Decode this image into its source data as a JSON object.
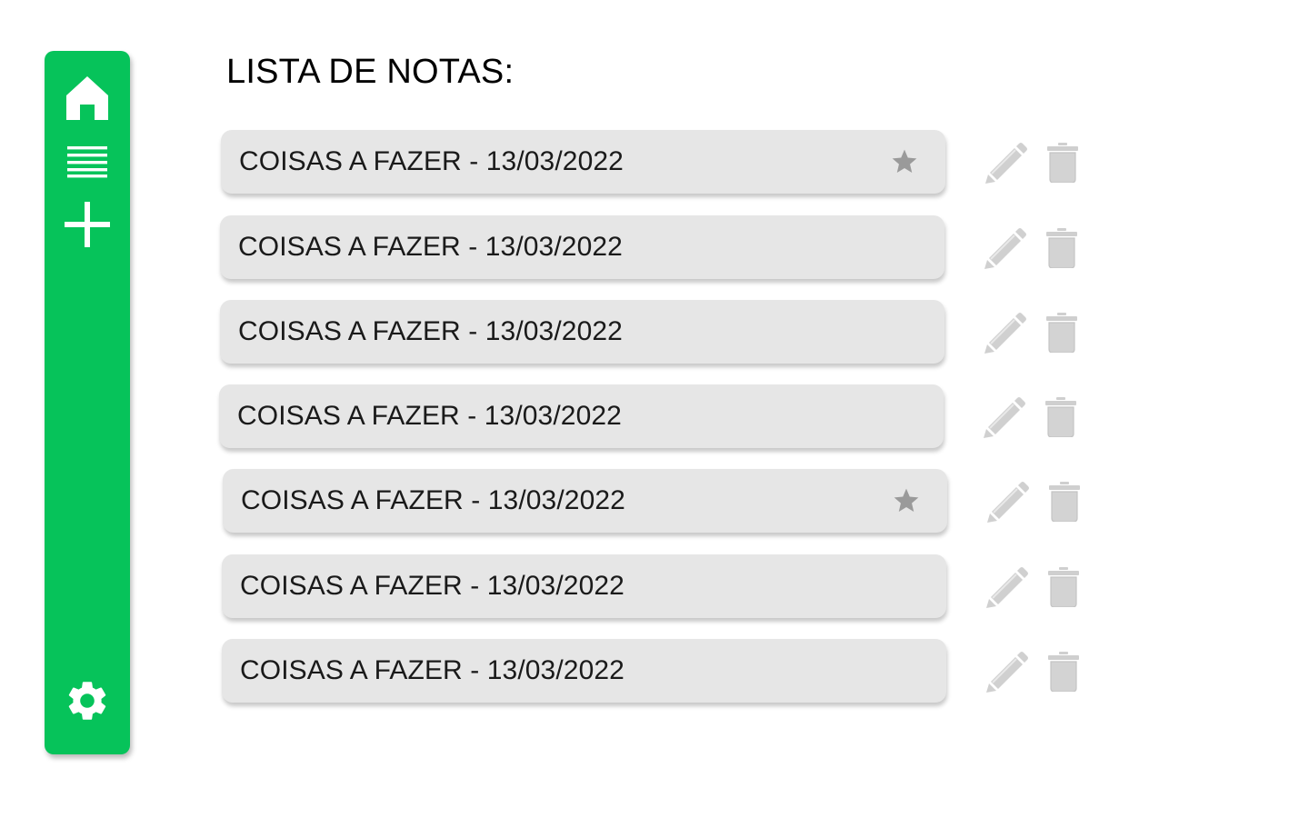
{
  "sidebar": {
    "color": "#06c35a",
    "items": [
      {
        "icon": "home-icon"
      },
      {
        "icon": "list-icon"
      },
      {
        "icon": "plus-icon"
      },
      {
        "icon": "gear-icon"
      }
    ]
  },
  "title": "LISTA DE NOTAS:",
  "notes": [
    {
      "label": "COISAS A FAZER - 13/03/2022",
      "starred": true
    },
    {
      "label": "COISAS A FAZER - 13/03/2022",
      "starred": false
    },
    {
      "label": "COISAS A FAZER - 13/03/2022",
      "starred": false
    },
    {
      "label": "COISAS A FAZER - 13/03/2022",
      "starred": false
    },
    {
      "label": "COISAS A FAZER - 13/03/2022",
      "starred": true
    },
    {
      "label": "COISAS A FAZER - 13/03/2022",
      "starred": false
    },
    {
      "label": "COISAS A FAZER - 13/03/2022",
      "starred": false
    }
  ],
  "actions": {
    "edit_icon": "pencil-icon",
    "delete_icon": "trash-icon"
  },
  "colors": {
    "card": "#e6e6e6",
    "icon_gray": "#c9c9c9",
    "star": "#9a9a9a"
  }
}
